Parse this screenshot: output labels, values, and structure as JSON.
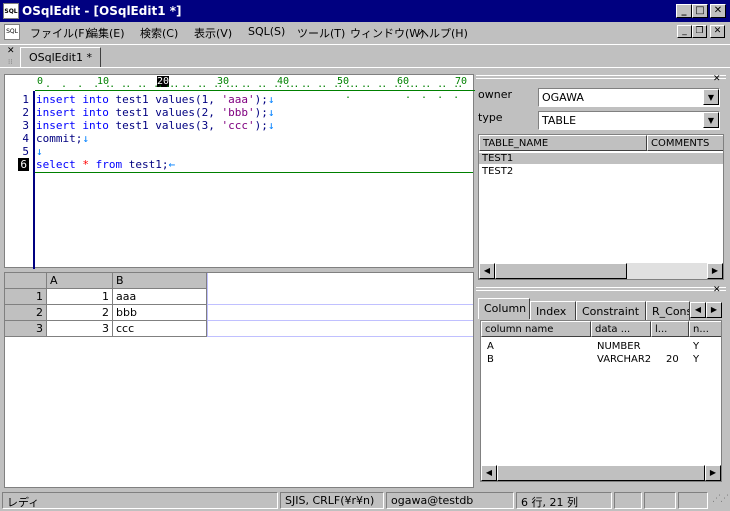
{
  "window": {
    "title": "OSqlEdit - [OSqlEdit1 *]",
    "app_icon": "SQL"
  },
  "menu": [
    "ファイル(F)",
    "編集(E)",
    "検索(C)",
    "表示(V)",
    "SQL(S)",
    "ツール(T)",
    "ウィンドウ(W)",
    "ヘルプ(H)"
  ],
  "tabs": [
    {
      "label": "OSqlEdit1 *"
    }
  ],
  "ruler": [
    "0",
    "10",
    "20",
    "30",
    "40",
    "50",
    "60",
    "70"
  ],
  "editor": {
    "line_numbers": [
      "1",
      "2",
      "3",
      "4",
      "5",
      "6"
    ],
    "lines": [
      {
        "kw": "insert into",
        "rest": " test1 values(1, ",
        "str": "'aaa'",
        "tail": ");",
        "nl": "↓"
      },
      {
        "kw": "insert into",
        "rest": " test1 values(2, ",
        "str": "'bbb'",
        "tail": ");",
        "nl": "↓"
      },
      {
        "kw": "insert into",
        "rest": " test1 values(3, ",
        "str": "'ccc'",
        "tail": ");",
        "nl": "↓"
      },
      {
        "kw": "",
        "rest": "commit;",
        "str": "",
        "tail": "",
        "nl": "↓"
      },
      {
        "kw": "",
        "rest": "",
        "str": "",
        "tail": "",
        "nl": "↓"
      },
      {
        "kw": "select",
        "rest": " ",
        "ast": "*",
        "kw2": "from",
        "tail": " test1;",
        "nl": "←"
      }
    ]
  },
  "result_grid": {
    "headers": [
      "A",
      "B"
    ],
    "rows": [
      {
        "num": "1",
        "a": "1",
        "b": "aaa"
      },
      {
        "num": "2",
        "a": "2",
        "b": "bbb"
      },
      {
        "num": "3",
        "a": "3",
        "b": "ccc"
      }
    ]
  },
  "object_panel": {
    "owner_label": "owner",
    "owner_value": "OGAWA",
    "type_label": "type",
    "type_value": "TABLE",
    "columns": [
      "TABLE_NAME",
      "COMMENTS"
    ],
    "tables": [
      "TEST1",
      "TEST2"
    ]
  },
  "column_panel": {
    "tabs": [
      "Column",
      "Index",
      "Constraint",
      "R_Cons"
    ],
    "headers": [
      "column name",
      "data ...",
      "l...",
      "n..."
    ],
    "rows": [
      {
        "name": "A",
        "type": "NUMBER",
        "len": "",
        "null": "Y"
      },
      {
        "name": "B",
        "type": "VARCHAR2",
        "len": "20",
        "null": "Y"
      }
    ]
  },
  "status": {
    "state": "レディ",
    "encoding": "SJIS, CRLF(¥r¥n)",
    "connection": "ogawa@testdb",
    "position": "6 行, 21 列"
  }
}
